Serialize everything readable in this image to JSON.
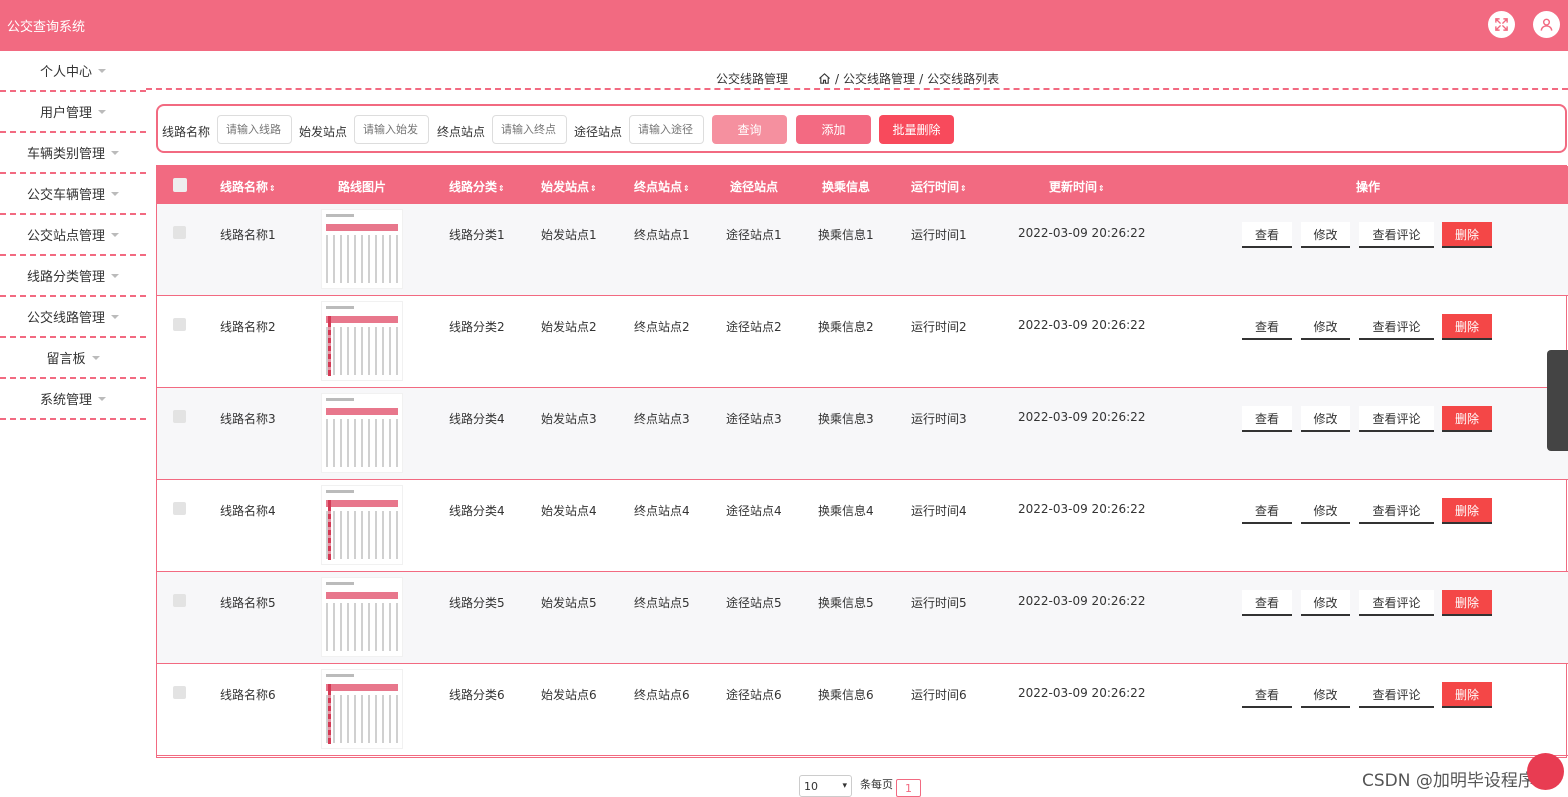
{
  "app": {
    "title": "公交查询系统"
  },
  "header_icons": [
    "fullscreen-icon",
    "user-icon"
  ],
  "sidebar": {
    "items": [
      {
        "label": "个人中心"
      },
      {
        "label": "用户管理"
      },
      {
        "label": "车辆类别管理"
      },
      {
        "label": "公交车辆管理"
      },
      {
        "label": "公交站点管理"
      },
      {
        "label": "线路分类管理"
      },
      {
        "label": "公交线路管理"
      },
      {
        "label": "留言板"
      },
      {
        "label": "系统管理"
      }
    ]
  },
  "breadcrumb": {
    "title": "公交线路管理",
    "sep": "/",
    "level1": "公交线路管理",
    "level2": "公交线路列表"
  },
  "search": {
    "route_name_label": "线路名称",
    "route_name_placeholder": "请输入线路",
    "start_label": "始发站点",
    "start_placeholder": "请输入始发",
    "end_label": "终点站点",
    "end_placeholder": "请输入终点",
    "via_label": "途径站点",
    "via_placeholder": "请输入途径",
    "query_btn": "查询",
    "add_btn": "添加",
    "batch_delete_btn": "批量删除"
  },
  "colors": {
    "accent": "#f26a81",
    "danger": "#f44747",
    "query_btn": "#f5909f",
    "add_btn": "#f36a82",
    "batch_btn": "#f84a5c"
  },
  "table": {
    "headers": {
      "route_name": "线路名称",
      "image": "路线图片",
      "category": "线路分类",
      "start": "始发站点",
      "end": "终点站点",
      "via": "途径站点",
      "transfer": "换乘信息",
      "run_time": "运行时间",
      "updated": "更新时间",
      "actions": "操作"
    },
    "rows": [
      {
        "route_name": "线路名称1",
        "category": "线路分类1",
        "start": "始发站点1",
        "end": "终点站点1",
        "via": "途径站点1",
        "transfer": "换乘信息1",
        "run_time": "运行时间1",
        "updated": "2022-03-09 20:26:22"
      },
      {
        "route_name": "线路名称2",
        "category": "线路分类2",
        "start": "始发站点2",
        "end": "终点站点2",
        "via": "途径站点2",
        "transfer": "换乘信息2",
        "run_time": "运行时间2",
        "updated": "2022-03-09 20:26:22"
      },
      {
        "route_name": "线路名称3",
        "category": "线路分类4",
        "start": "始发站点3",
        "end": "终点站点3",
        "via": "途径站点3",
        "transfer": "换乘信息3",
        "run_time": "运行时间3",
        "updated": "2022-03-09 20:26:22"
      },
      {
        "route_name": "线路名称4",
        "category": "线路分类4",
        "start": "始发站点4",
        "end": "终点站点4",
        "via": "途径站点4",
        "transfer": "换乘信息4",
        "run_time": "运行时间4",
        "updated": "2022-03-09 20:26:22"
      },
      {
        "route_name": "线路名称5",
        "category": "线路分类5",
        "start": "始发站点5",
        "end": "终点站点5",
        "via": "途径站点5",
        "transfer": "换乘信息5",
        "run_time": "运行时间5",
        "updated": "2022-03-09 20:26:22"
      },
      {
        "route_name": "线路名称6",
        "category": "线路分类6",
        "start": "始发站点6",
        "end": "终点站点6",
        "via": "途径站点6",
        "transfer": "换乘信息6",
        "run_time": "运行时间6",
        "updated": "2022-03-09 20:26:22"
      }
    ],
    "actions": {
      "view": "查看",
      "edit": "修改",
      "comments": "查看评论",
      "delete": "删除"
    }
  },
  "pagination": {
    "page_size": "10",
    "per_page_label": "条每页",
    "current_page": "1"
  },
  "watermark": "CSDN @加明毕设程序"
}
